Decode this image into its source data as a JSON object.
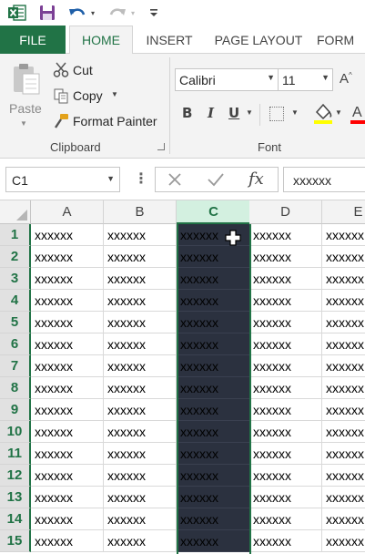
{
  "qat": {
    "undo_arrow": "▾",
    "redo_arrow": "▾"
  },
  "tabs": [
    {
      "label": "FILE"
    },
    {
      "label": "HOME"
    },
    {
      "label": "INSERT"
    },
    {
      "label": "PAGE LAYOUT"
    },
    {
      "label": "FORM"
    }
  ],
  "clipboard": {
    "paste_label": "Paste",
    "cut_label": "Cut",
    "copy_label": "Copy",
    "format_painter_label": "Format Painter",
    "group_label": "Clipboard"
  },
  "font": {
    "name": "Calibri",
    "size": "11",
    "group_label": "Font",
    "fill_color": "#ffff00",
    "font_color": "#ff0000"
  },
  "formula_bar": {
    "name_box": "C1",
    "value": "xxxxxx"
  },
  "sheet": {
    "columns": [
      "A",
      "B",
      "C",
      "D",
      "E"
    ],
    "selected_column": "C",
    "rows": [
      "1",
      "2",
      "3",
      "4",
      "5",
      "6",
      "7",
      "8",
      "9",
      "10",
      "11",
      "12",
      "13",
      "14",
      "15"
    ],
    "cell_value": "xxxxxx"
  },
  "colors": {
    "accent": "#217346",
    "selection": "#2b313f"
  }
}
